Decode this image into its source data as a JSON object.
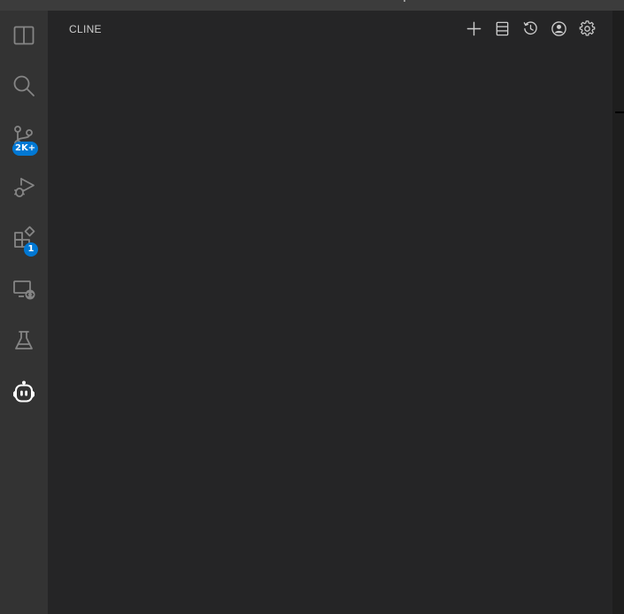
{
  "activity_bar": {
    "items": [
      {
        "icon": "explorer-icon"
      },
      {
        "icon": "search-icon"
      },
      {
        "icon": "source-control-icon",
        "badge": "2K+"
      },
      {
        "icon": "run-debug-icon"
      },
      {
        "icon": "extensions-icon",
        "badge": "1"
      },
      {
        "icon": "remote-explorer-icon"
      },
      {
        "icon": "testing-icon"
      },
      {
        "icon": "cline-robot-icon",
        "active": true
      }
    ]
  },
  "side_panel": {
    "title": "CLINE",
    "toolbar": [
      "new-task-icon",
      "mcp-servers-icon",
      "history-icon",
      "account-icon",
      "settings-icon"
    ]
  },
  "colors": {
    "activity_bar_bg": "#333333",
    "side_panel_bg": "#252526",
    "editor_bg": "#1e1e1e",
    "badge_bg": "#0078d4",
    "icon_inactive": "#858585",
    "icon_active": "#ffffff"
  }
}
